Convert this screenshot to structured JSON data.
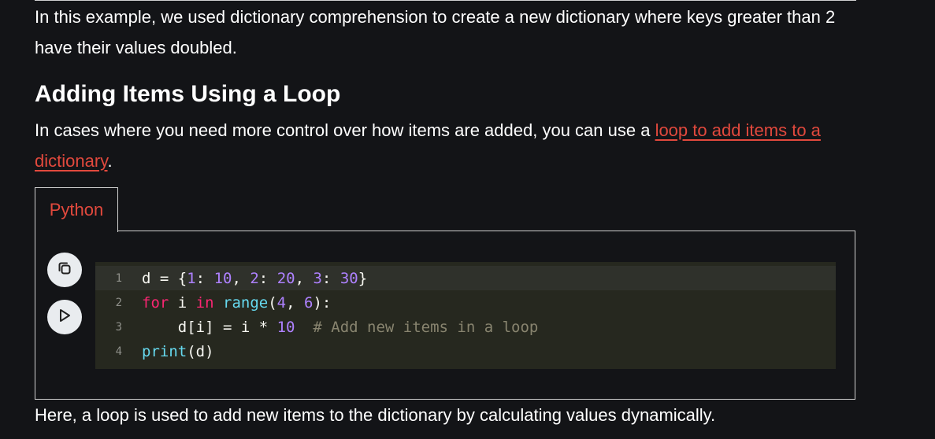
{
  "paragraphs": {
    "intro": "In this example, we used dictionary comprehension to create a new dictionary where keys greater than 2 have their values doubled.",
    "loop_prefix": "In cases where you need more control over how items are added, you can use a ",
    "loop_link": "loop to add items to a dictionary",
    "loop_suffix": ".",
    "outro": "Here, a loop is used to add new items to the dictionary by calculating values dynamically."
  },
  "heading": "Adding Items Using a Loop",
  "code_block": {
    "tab_label": "Python",
    "copy_icon": "copy-icon",
    "run_icon": "play-icon",
    "line_numbers": [
      "1",
      "2",
      "3",
      "4"
    ],
    "lines": [
      "d = {1: 10, 2: 20, 3: 30}",
      "for i in range(4, 6):",
      "    d[i] = i * 10  # Add new items in a loop",
      "print(d)"
    ],
    "tokens": {
      "l1": [
        "d",
        " = {",
        "1",
        ": ",
        "10",
        ", ",
        "2",
        ": ",
        "20",
        ", ",
        "3",
        ": ",
        "30",
        "}"
      ],
      "l2": [
        "for",
        " i ",
        "in",
        " ",
        "range",
        "(",
        "4",
        ", ",
        "6",
        "):"
      ],
      "l3": [
        "    d[i] = i * ",
        "10",
        "  ",
        "# Add new items in a loop"
      ],
      "l4": [
        "print",
        "(d)"
      ]
    }
  },
  "colors": {
    "background": "#131417",
    "link": "#e2493d",
    "editor_bg": "#26281f"
  }
}
